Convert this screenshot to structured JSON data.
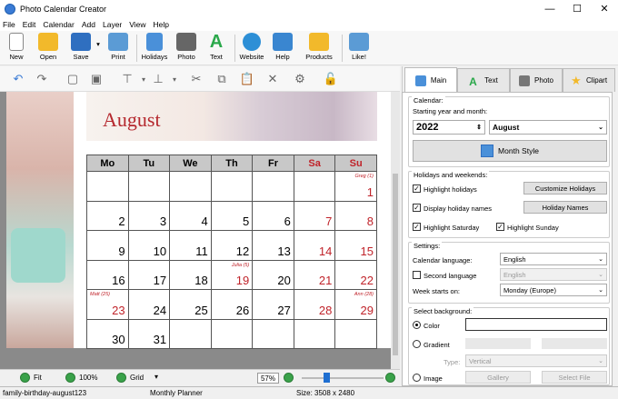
{
  "window": {
    "title": "Photo Calendar Creator",
    "minimize": "—",
    "maximize": "☐",
    "close": "✕"
  },
  "menu": [
    "File",
    "Edit",
    "Calendar",
    "Add",
    "Layer",
    "View",
    "Help"
  ],
  "toolbar": {
    "new": "New",
    "open": "Open",
    "save": "Save",
    "print": "Print",
    "holidays": "Holidays",
    "photo": "Photo",
    "text": "Text",
    "website": "Website",
    "help": "Help",
    "products": "Products",
    "like": "Like!"
  },
  "calendar": {
    "month": "August",
    "weekdays": [
      "Mo",
      "Tu",
      "We",
      "Th",
      "Fr",
      "Sa",
      "Su"
    ],
    "weeks": [
      [
        {
          "d": ""
        },
        {
          "d": ""
        },
        {
          "d": ""
        },
        {
          "d": ""
        },
        {
          "d": ""
        },
        {
          "d": ""
        },
        {
          "d": "1",
          "h": "Greg (1)"
        }
      ],
      [
        {
          "d": "2"
        },
        {
          "d": "3"
        },
        {
          "d": "4"
        },
        {
          "d": "5"
        },
        {
          "d": "6"
        },
        {
          "d": "7"
        },
        {
          "d": "8"
        }
      ],
      [
        {
          "d": "9"
        },
        {
          "d": "10"
        },
        {
          "d": "11"
        },
        {
          "d": "12"
        },
        {
          "d": "13"
        },
        {
          "d": "14"
        },
        {
          "d": "15"
        }
      ],
      [
        {
          "d": "16"
        },
        {
          "d": "17"
        },
        {
          "d": "18"
        },
        {
          "d": "19",
          "h": "Julia (5)"
        },
        {
          "d": "20"
        },
        {
          "d": "21"
        },
        {
          "d": "22"
        }
      ],
      [
        {
          "d": "23",
          "h": "Matt (25)"
        },
        {
          "d": "24"
        },
        {
          "d": "25"
        },
        {
          "d": "26"
        },
        {
          "d": "27"
        },
        {
          "d": "28"
        },
        {
          "d": "29",
          "h": "Ann (28)"
        }
      ],
      [
        {
          "d": "30"
        },
        {
          "d": "31"
        },
        {
          "d": ""
        },
        {
          "d": ""
        },
        {
          "d": ""
        },
        {
          "d": ""
        },
        {
          "d": ""
        }
      ]
    ],
    "red_days": [
      "1",
      "7",
      "8",
      "14",
      "15",
      "19",
      "21",
      "22",
      "23",
      "28",
      "29"
    ]
  },
  "zoom": {
    "fit": "Fit",
    "percent100": "100%",
    "grid": "Grid",
    "level": "57%",
    "slider_fraction": 0.3
  },
  "status": {
    "file": "family-birthday-august123",
    "template": "Monthly Planner",
    "size": "Size: 3508 x 2480"
  },
  "tabs": [
    "Main",
    "Text",
    "Photo",
    "Clipart"
  ],
  "panel": {
    "calendar_group": "Calendar:",
    "start_label": "Starting year and month:",
    "year": "2022",
    "month": "August",
    "month_style": "Month Style",
    "holidays_group": "Holidays and weekends:",
    "highlight_holidays": "Highlight holidays",
    "customize_holidays": "Customize Holidays",
    "display_names": "Display holiday names",
    "holiday_names": "Holiday Names",
    "highlight_saturday": "Highlight Saturday",
    "highlight_sunday": "Highlight Sunday",
    "settings_group": "Settings:",
    "cal_language_label": "Calendar language:",
    "cal_language": "English",
    "second_language_label": "Second language",
    "second_language": "English",
    "week_starts_label": "Week starts on:",
    "week_starts": "Monday (Europe)",
    "background_group": "Select background:",
    "color": "Color",
    "gradient": "Gradient",
    "type_label": "Type:",
    "type_value": "Vertical",
    "image": "Image",
    "gallery": "Gallery",
    "select_file": "Select File"
  }
}
